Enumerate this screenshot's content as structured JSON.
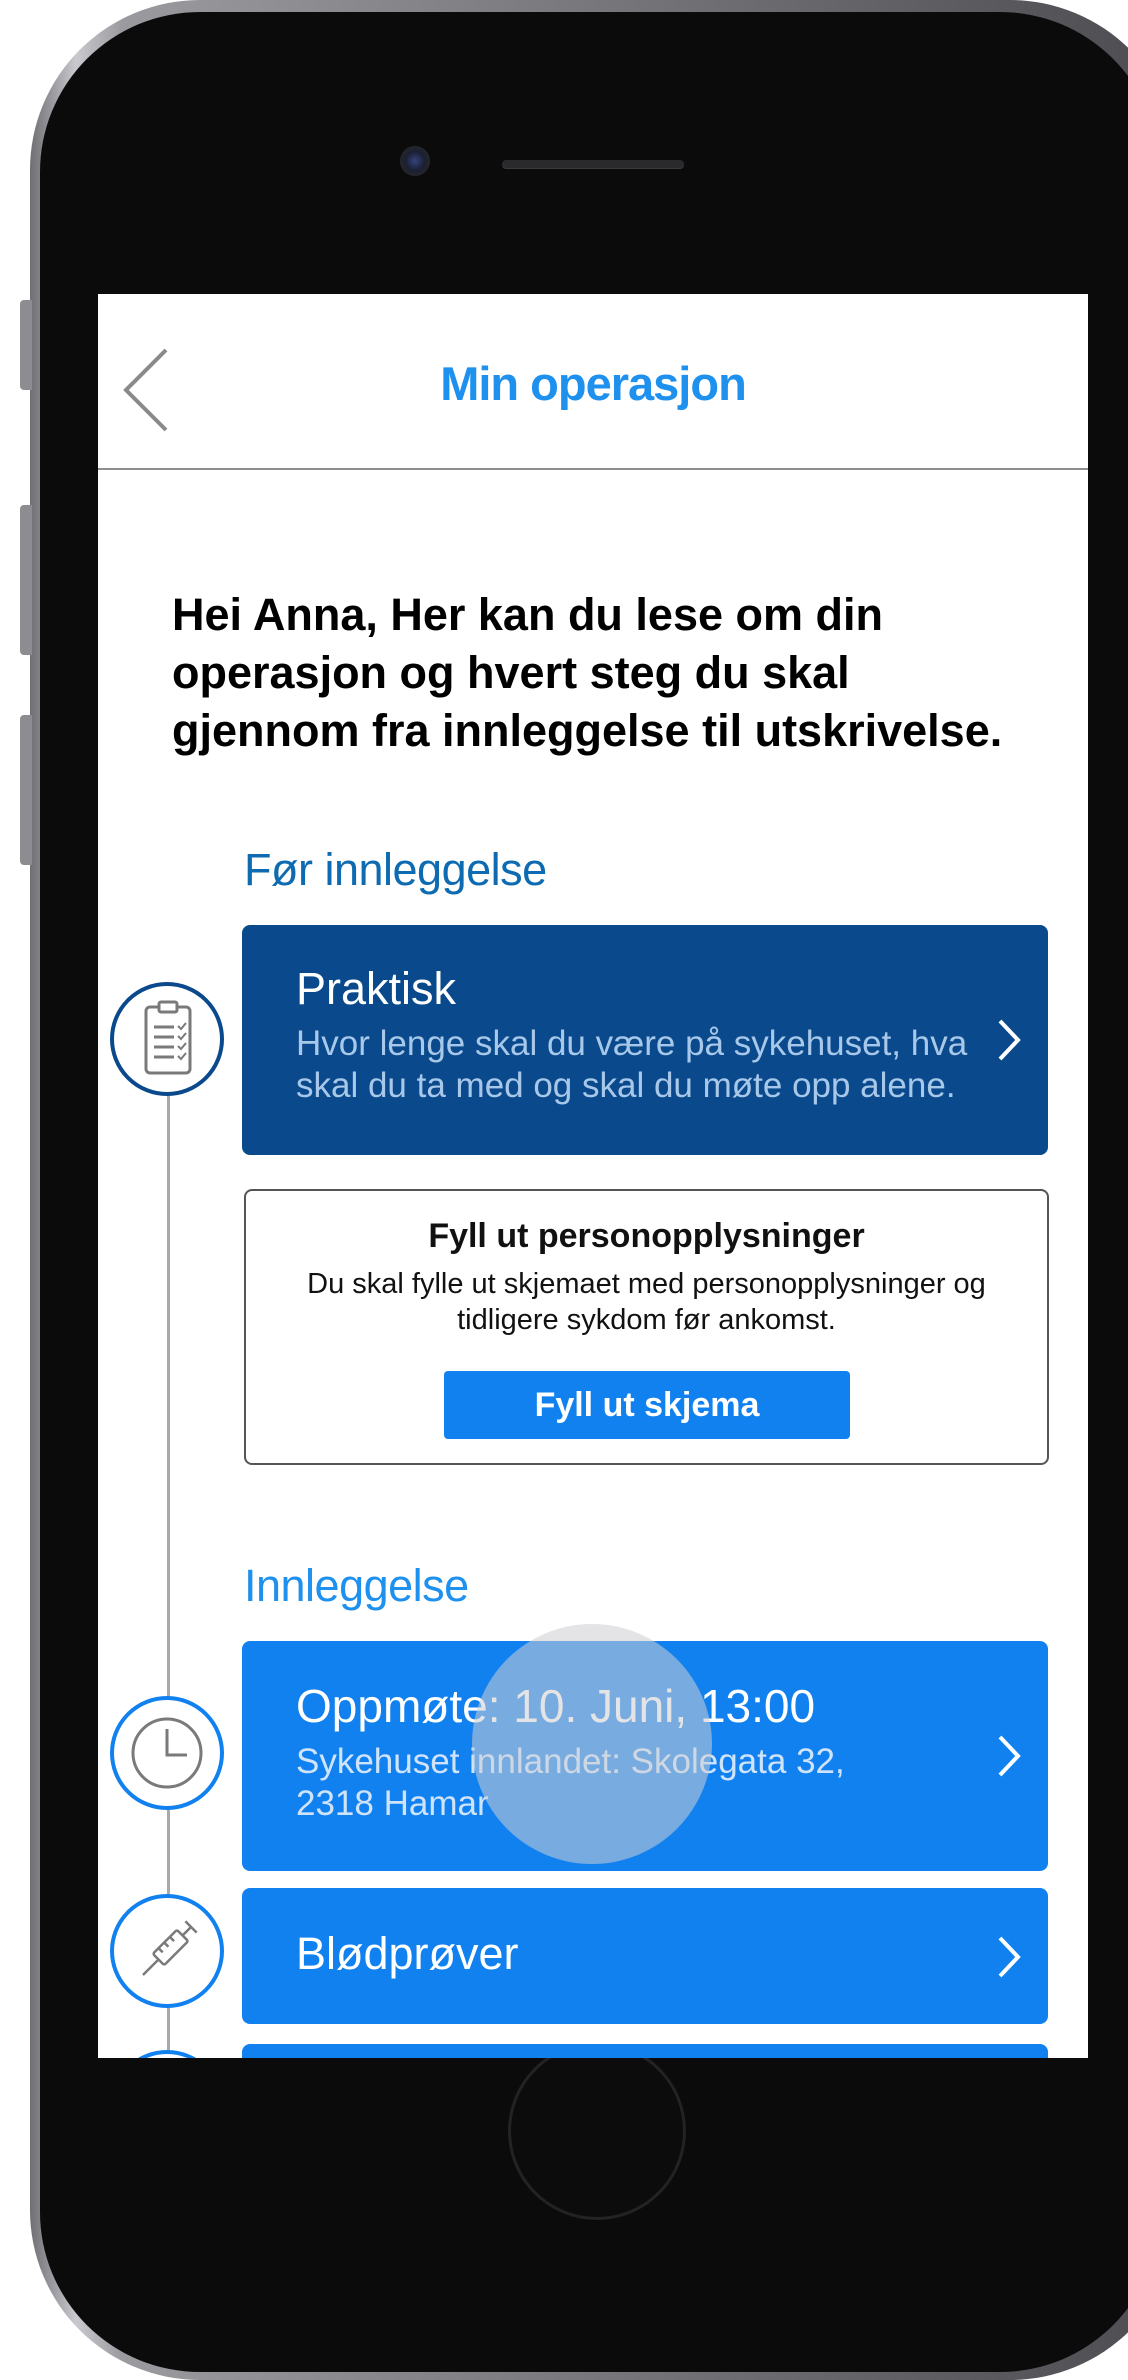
{
  "nav": {
    "title": "Min operasjon"
  },
  "greeting": "Hei Anna, Her kan du lese om din operasjon og hvert steg du skal gjennom fra innleggelse til utskrivelse.",
  "sections": [
    {
      "heading": "Før innleggelse"
    },
    {
      "heading": "Innleggelse"
    }
  ],
  "cards": {
    "praktisk": {
      "title": "Praktisk",
      "subtitle": "Hvor lenge skal du være på sykehuset, hva skal du ta med og skal du møte opp alene.",
      "color": "#0a4a8c"
    },
    "form": {
      "title": "Fyll ut personopplysninger",
      "text": "Du skal fylle ut skjemaet med personopplysninger og tidligere sykdom før ankomst.",
      "button": "Fyll ut skjema"
    },
    "oppmote": {
      "title": "Oppmøte: 10. Juni, 13:00",
      "subtitle": "Sykehuset innlandet: Skolegata 32, 2318 Hamar",
      "color": "#1181f0"
    },
    "blodprover": {
      "title": "Blødprøver",
      "color": "#1181f0"
    }
  },
  "icons": [
    "clipboard-icon",
    "clock-icon",
    "syringe-icon",
    "back-chevron-icon",
    "chevron-right-icon"
  ]
}
